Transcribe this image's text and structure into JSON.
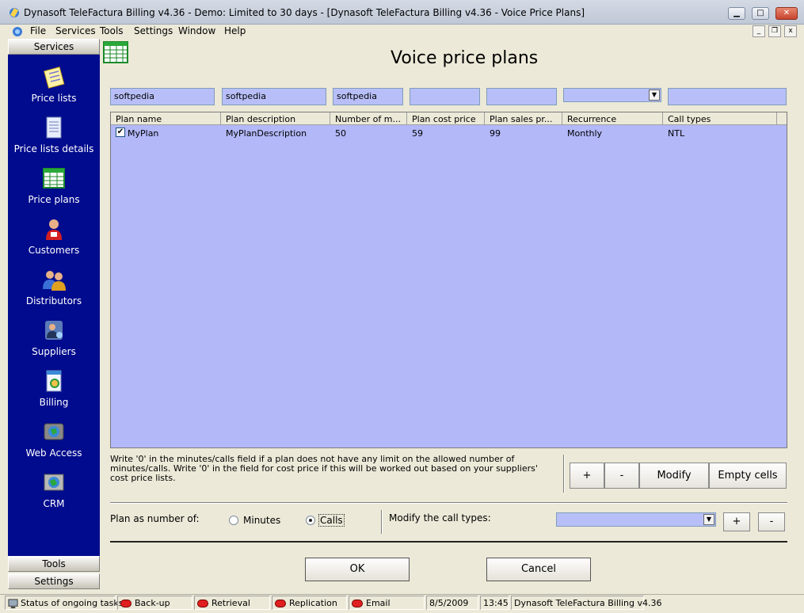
{
  "window": {
    "title": "Dynasoft TeleFactura Billing v4.36 - Demo: Limited to 30 days - [Dynasoft TeleFactura Billing v4.36 - Voice Price Plans]",
    "min_glyph": "▁",
    "max_glyph": "□",
    "close_glyph": "✕"
  },
  "menu": {
    "items": [
      "File",
      "Services",
      "Tools",
      "Settings",
      "Window",
      "Help"
    ],
    "mdi_min": "_",
    "mdi_restore": "❐",
    "mdi_close": "x"
  },
  "sidebar": {
    "header_services": "Services",
    "items": [
      {
        "label": "Price lists",
        "icon": "notepad-icon"
      },
      {
        "label": "Price lists details",
        "icon": "document-icon"
      },
      {
        "label": "Price plans",
        "icon": "spreadsheet-icon"
      },
      {
        "label": "Customers",
        "icon": "customer-icon"
      },
      {
        "label": "Distributors",
        "icon": "group-icon"
      },
      {
        "label": "Suppliers",
        "icon": "supplier-icon"
      },
      {
        "label": "Billing",
        "icon": "billing-icon"
      },
      {
        "label": "Web Access",
        "icon": "web-icon"
      },
      {
        "label": "CRM",
        "icon": "crm-icon"
      }
    ],
    "footer_tools": "Tools",
    "footer_settings": "Settings"
  },
  "main": {
    "title": "Voice price plans",
    "filters": [
      "softpedia",
      "softpedia",
      "softpedia",
      "",
      "",
      "",
      ""
    ],
    "grid": {
      "columns": [
        "Plan name",
        "Plan description",
        "Number of m...",
        "Plan cost price",
        "Plan sales pr...",
        "Recurrence",
        "Call types"
      ],
      "rows": [
        {
          "checked": true,
          "cells": [
            "MyPlan",
            "MyPlanDescription",
            "50",
            "59",
            "99",
            "Monthly",
            "NTL"
          ]
        }
      ]
    },
    "note": "Write '0' in the minutes/calls field if a plan does not have any limit on the allowed number of minutes/calls. Write '0' in the field for cost price if this will be worked out based on your suppliers' cost price lists.",
    "buttons": {
      "add": "+",
      "remove": "-",
      "modify": "Modify",
      "empty_cells": "Empty cells"
    },
    "plan_as_label": "Plan as number of:",
    "radio_minutes": "Minutes",
    "radio_calls": "Calls",
    "selected_mode": "Calls",
    "modify_call_types_label": "Modify the call types:",
    "call_types_add": "+",
    "call_types_remove": "-",
    "ok": "OK",
    "cancel": "Cancel"
  },
  "statusbar": {
    "label": "Status of ongoing tasks:",
    "tasks": [
      "Back-up",
      "Retrieval",
      "Replication",
      "Email"
    ],
    "date": "8/5/2009",
    "time": "13:45",
    "app": "Dynasoft TeleFactura Billing v4.36"
  },
  "colors": {
    "sidebar_bg": "#010b8d",
    "grid_bg": "#b2b8f8",
    "field_bg": "#b8bff8",
    "status_led": "#e02020"
  }
}
